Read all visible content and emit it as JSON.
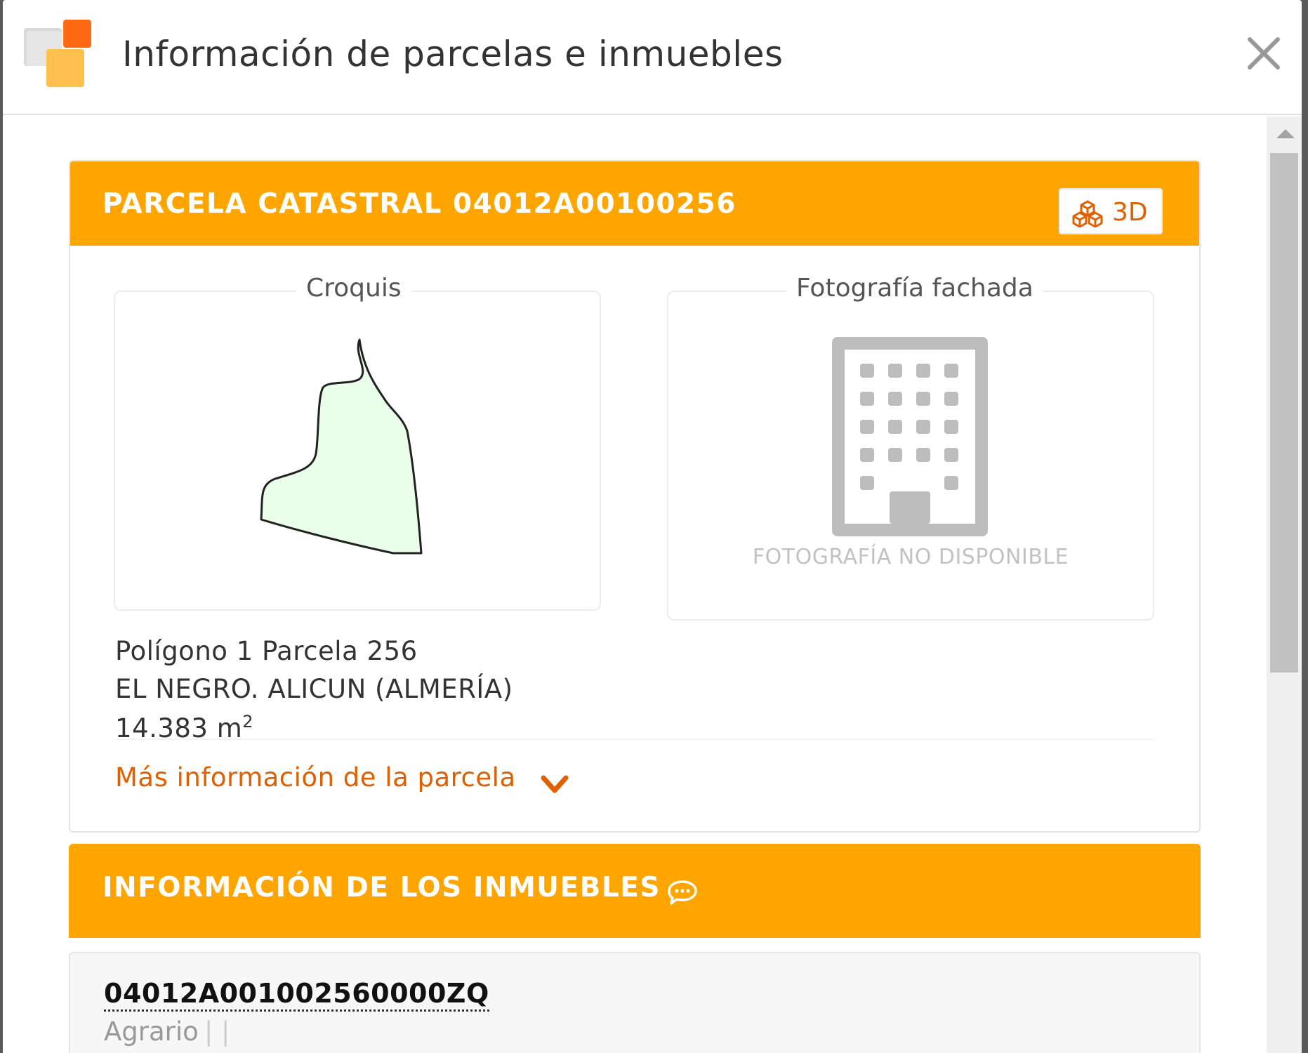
{
  "modal": {
    "title": "Información de parcelas e inmuebles"
  },
  "parcel": {
    "header_title": "PARCELA CATASTRAL 04012A00100256",
    "btn_3d_label": "3D",
    "croquis_label": "Croquis",
    "photo_label": "Fotografía fachada",
    "photo_unavailable": "FOTOGRAFÍA NO DISPONIBLE",
    "location_line": "Polígono 1 Parcela 256",
    "address_line": "EL NEGRO. ALICUN (ALMERÍA)",
    "area_value": "14.383 m",
    "area_unit_exp": "2",
    "more_info_link": "Más información de la parcela"
  },
  "properties": {
    "section_title": "INFORMACIÓN DE LOS INMUEBLES",
    "items": [
      {
        "reference": "04012A001002560000ZQ",
        "use": "Agrario",
        "separators": "| |"
      }
    ]
  },
  "colors": {
    "accent": "#ffa500",
    "link": "#e06000",
    "sketch_fill": "#eaffea"
  },
  "icons": {
    "close": "close-icon",
    "cube": "cubes-icon",
    "chat": "chat-bubble-icon",
    "chevron": "chevron-down-icon",
    "building": "building-icon"
  }
}
